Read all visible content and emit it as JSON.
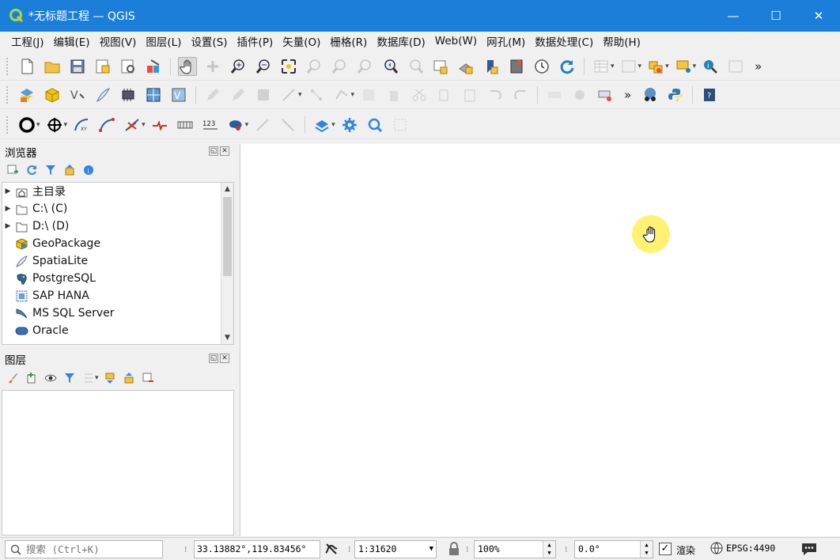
{
  "window": {
    "title": "*无标题工程 — QGIS",
    "controls": {
      "minimize": "—",
      "maximize": "☐",
      "close": "✕"
    }
  },
  "menu": [
    "工程(J)",
    "编辑(E)",
    "视图(V)",
    "图层(L)",
    "设置(S)",
    "插件(P)",
    "矢量(O)",
    "栅格(R)",
    "数据库(D)",
    "Web(W)",
    "网孔(M)",
    "数据处理(C)",
    "帮助(H)"
  ],
  "toolbars": {
    "more_glyph": "»",
    "row3_label_123": "123"
  },
  "browser_panel": {
    "title": "浏览器",
    "items": [
      {
        "label": "主目录",
        "icon": "home-folder-icon",
        "expandable": true
      },
      {
        "label": "C:\\ (C)",
        "icon": "folder-icon",
        "expandable": true
      },
      {
        "label": "D:\\ (D)",
        "icon": "folder-icon",
        "expandable": true
      },
      {
        "label": "GeoPackage",
        "icon": "geopackage-icon",
        "expandable": false
      },
      {
        "label": "SpatiaLite",
        "icon": "spatialite-feather-icon",
        "expandable": false
      },
      {
        "label": "PostgreSQL",
        "icon": "postgresql-elephant-icon",
        "expandable": false
      },
      {
        "label": "SAP HANA",
        "icon": "sap-hana-icon",
        "expandable": false
      },
      {
        "label": "MS SQL Server",
        "icon": "mssql-icon",
        "expandable": false
      },
      {
        "label": "Oracle",
        "icon": "oracle-icon",
        "expandable": false
      }
    ]
  },
  "layers_panel": {
    "title": "图层"
  },
  "statusbar": {
    "search_placeholder": "搜索 (Ctrl+K)",
    "coordinate": "33.13882°,119.83456°",
    "scale": "1:31620",
    "magnifier": "100%",
    "rotation": "0.0°",
    "render_label": "渲染",
    "render_checked": true,
    "crs": "EPSG:4490"
  },
  "colors": {
    "titlebar": "#1b7fd9",
    "cursor_highlight": "#fff05a"
  }
}
